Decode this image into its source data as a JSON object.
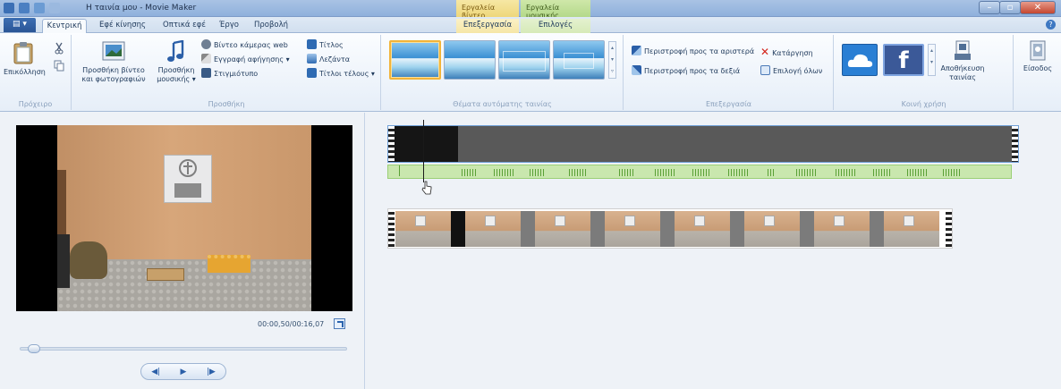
{
  "window": {
    "title": "Η ταινία μου - Movie Maker",
    "context_tabs": [
      "Εργαλεία βίντεο",
      "Εργαλεία μουσικής"
    ]
  },
  "tabs": [
    {
      "label": "Κεντρική",
      "active": true
    },
    {
      "label": "Εφέ κίνησης"
    },
    {
      "label": "Οπτικά εφέ"
    },
    {
      "label": "Έργο"
    },
    {
      "label": "Προβολή"
    },
    {
      "label": "Επεξεργασία",
      "context": "video"
    },
    {
      "label": "Επιλογές",
      "context": "music"
    }
  ],
  "ribbon": {
    "clipboard": {
      "paste": "Επικόλληση",
      "label": "Πρόχειρο"
    },
    "add": {
      "add_videos": "Προσθήκη βίντεο και φωτογραφιών",
      "add_music": "Προσθήκη μουσικής",
      "webcam": "Βίντεο κάμερας web",
      "narration": "Εγγραφή αφήγησης",
      "snapshot": "Στιγμιότυπο",
      "title": "Τίτλος",
      "caption": "Λεζάντα",
      "credits": "Τίτλοι τέλους",
      "label": "Προσθήκη"
    },
    "themes": {
      "label": "Θέματα αυτόματης ταινίας"
    },
    "editing": {
      "rotate_left": "Περιστροφή προς τα αριστερά",
      "rotate_right": "Περιστροφή προς τα δεξιά",
      "remove": "Κατάργηση",
      "select_all": "Επιλογή όλων",
      "label": "Επεξεργασία"
    },
    "share": {
      "label": "Κοινή χρήση"
    },
    "save_movie": "Αποθήκευση ταινίας",
    "sign_in": "Είσοδος"
  },
  "preview": {
    "timecode": "00:00,50/00:16,07"
  },
  "colors": {
    "accent": "#2b5fa8",
    "selection": "#f2b43a",
    "audio": "#c9e7ae"
  }
}
